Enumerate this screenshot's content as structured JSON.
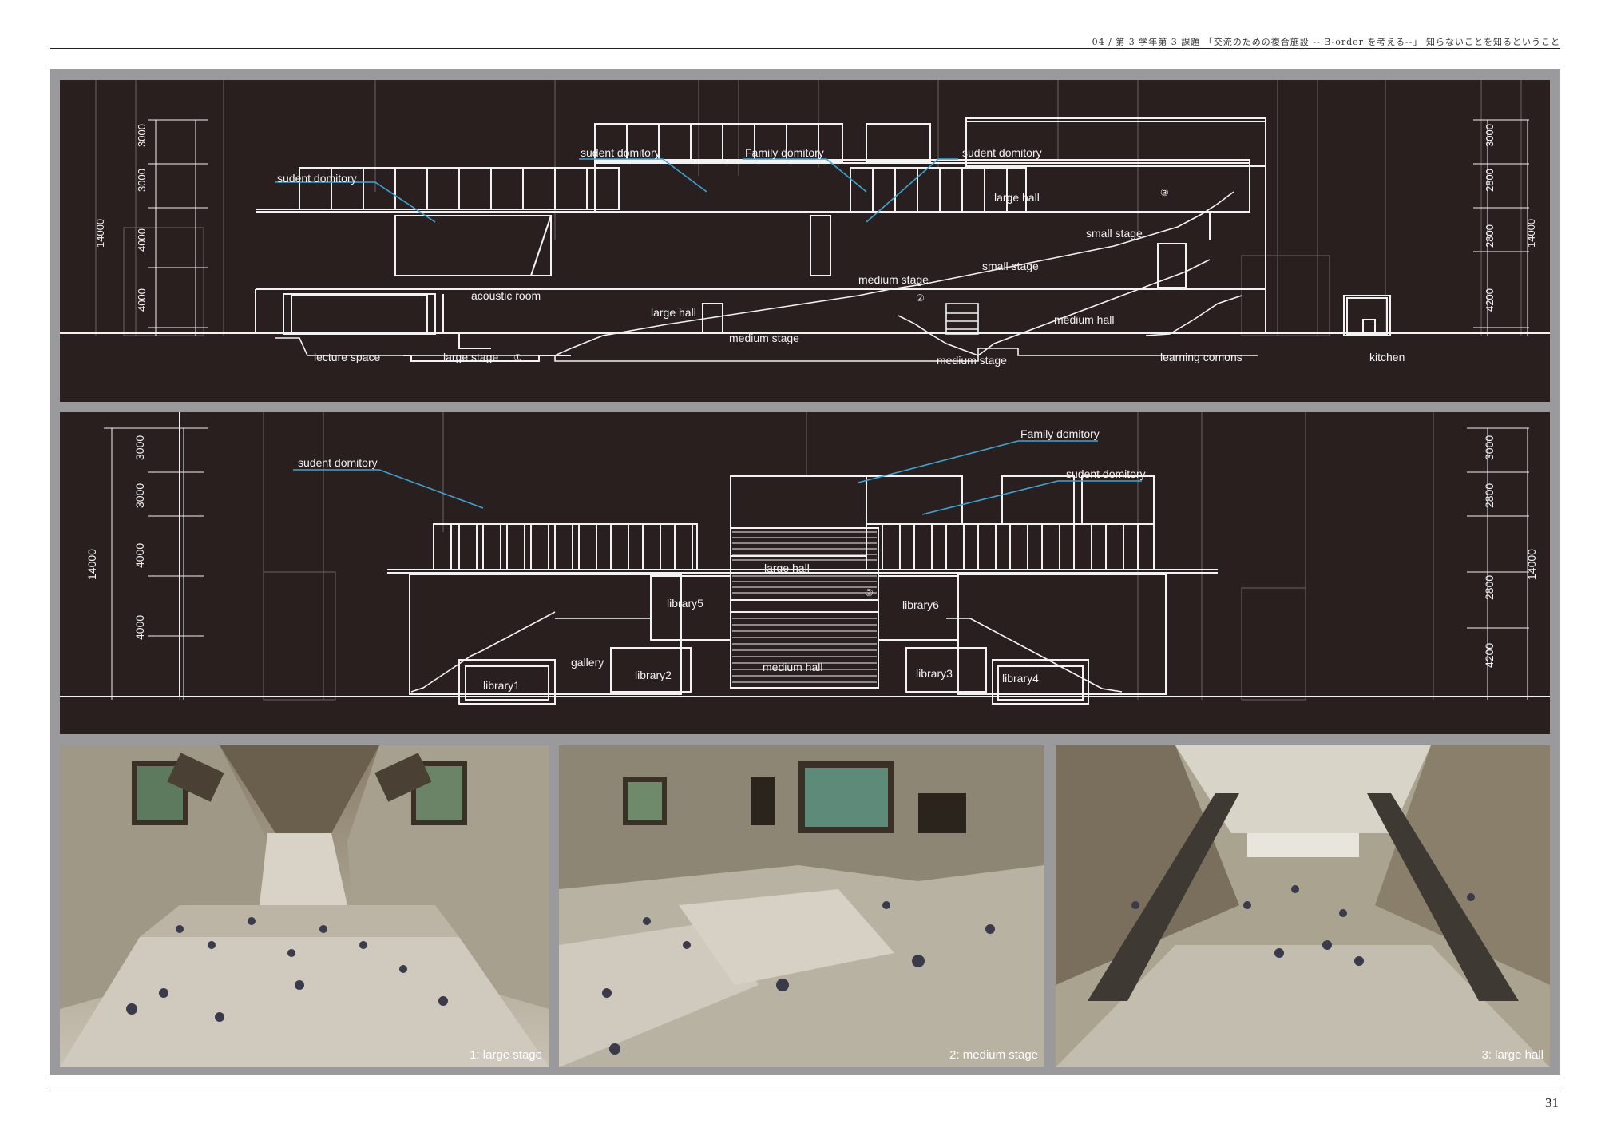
{
  "header": {
    "text": "04 / 第 3 学年第 3 課題 「交流のための複合施設 -- B-order を考える--」 知らないことを知るということ"
  },
  "page_number": "31",
  "section_a": {
    "labels": {
      "sudent_left": "sudent domitory",
      "sudent_mid": "sudent domitory",
      "family": "Family domitory",
      "sudent_right": "sudent domitory",
      "large_hall_top": "large hall",
      "marker_3": "③",
      "small_stage_1": "small stage",
      "small_stage_2": "small stage",
      "medium_stage_upper": "medium stage",
      "marker_2": "②",
      "acoustic_room": "acoustic room",
      "large_hall_mid": "large hall",
      "medium_hall": "medium hall",
      "medium_stage_mid": "medium stage",
      "lecture_space": "lecture space",
      "large_stage": "large stage",
      "marker_1": "①",
      "medium_stage_low": "medium stage",
      "learning_comons": "learning comons",
      "kitchen": "kitchen"
    },
    "dims_left": [
      "3000",
      "3000",
      "4000",
      "4000"
    ],
    "dim_left_total": "14000",
    "dims_right": [
      "3000",
      "2800",
      "2800",
      "4200"
    ],
    "dim_right_total": "14000"
  },
  "section_b": {
    "labels": {
      "sudent_left": "sudent domitory",
      "family": "Family domitory",
      "sudent_right": "sudent domitory",
      "large_hall": "large hall",
      "marker_2": "②",
      "library5": "library5",
      "library6": "library6",
      "gallery": "gallery",
      "library1": "library1",
      "library2": "library2",
      "medium_hall": "medium hall",
      "library3": "library3",
      "library4": "library4"
    },
    "dims_left": [
      "3000",
      "3000",
      "4000",
      "4000"
    ],
    "dim_left_total": "14000",
    "dims_right": [
      "3000",
      "2800",
      "2800",
      "4200"
    ],
    "dim_right_total": "14000"
  },
  "renders": [
    {
      "caption": "1: large stage"
    },
    {
      "caption": "2: medium stage"
    },
    {
      "caption": "3: large hall"
    }
  ],
  "colors": {
    "panel_bg": "#2a1f1f",
    "line": "#f2f2f2",
    "leader": "#3aa6d6",
    "frame": "#9a9a9c"
  }
}
